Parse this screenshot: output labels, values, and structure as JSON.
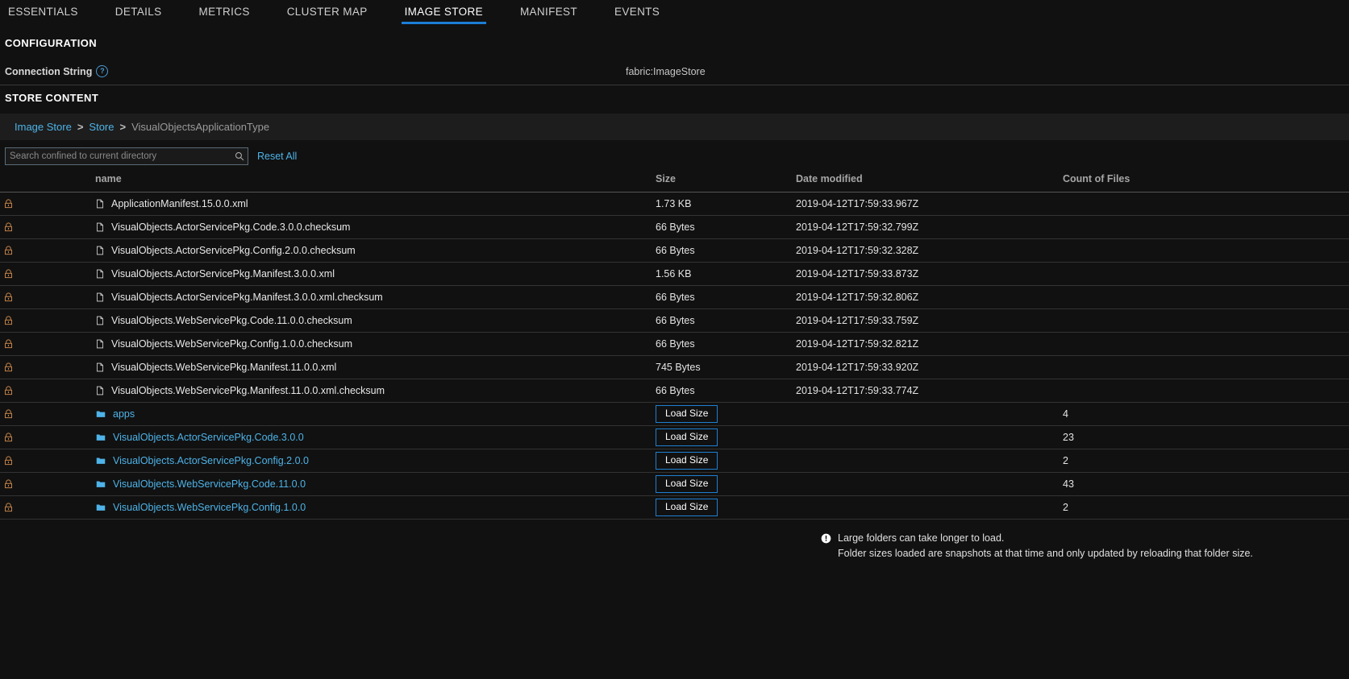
{
  "tabs": [
    {
      "label": "ESSENTIALS",
      "active": false
    },
    {
      "label": "DETAILS",
      "active": false
    },
    {
      "label": "METRICS",
      "active": false
    },
    {
      "label": "CLUSTER MAP",
      "active": false
    },
    {
      "label": "IMAGE STORE",
      "active": true
    },
    {
      "label": "MANIFEST",
      "active": false
    },
    {
      "label": "EVENTS",
      "active": false
    }
  ],
  "configuration": {
    "title": "CONFIGURATION",
    "connection_string_label": "Connection String",
    "help_glyph": "?",
    "connection_string_value": "fabric:ImageStore"
  },
  "store_content": {
    "title": "STORE CONTENT",
    "breadcrumb": {
      "items": [
        {
          "label": "Image Store",
          "link": true
        },
        {
          "label": "Store",
          "link": true
        },
        {
          "label": "VisualObjectsApplicationType",
          "link": false
        }
      ],
      "separator": ">"
    },
    "search": {
      "placeholder": "Search confined to current directory",
      "value": "",
      "icon": "search-icon"
    },
    "reset_all_label": "Reset All",
    "columns": [
      "name",
      "Size",
      "Date modified",
      "Count of Files"
    ],
    "load_size_label": "Load Size",
    "rows": [
      {
        "type": "file",
        "lock": "lock-icon",
        "name": "ApplicationManifest.15.0.0.xml",
        "size": "1.73 KB",
        "date": "2019-04-12T17:59:33.967Z",
        "count": ""
      },
      {
        "type": "file",
        "lock": "lock-icon",
        "name": "VisualObjects.ActorServicePkg.Code.3.0.0.checksum",
        "size": "66 Bytes",
        "date": "2019-04-12T17:59:32.799Z",
        "count": ""
      },
      {
        "type": "file",
        "lock": "lock-icon",
        "name": "VisualObjects.ActorServicePkg.Config.2.0.0.checksum",
        "size": "66 Bytes",
        "date": "2019-04-12T17:59:32.328Z",
        "count": ""
      },
      {
        "type": "file",
        "lock": "lock-icon",
        "name": "VisualObjects.ActorServicePkg.Manifest.3.0.0.xml",
        "size": "1.56 KB",
        "date": "2019-04-12T17:59:33.873Z",
        "count": ""
      },
      {
        "type": "file",
        "lock": "lock-icon",
        "name": "VisualObjects.ActorServicePkg.Manifest.3.0.0.xml.checksum",
        "size": "66 Bytes",
        "date": "2019-04-12T17:59:32.806Z",
        "count": ""
      },
      {
        "type": "file",
        "lock": "lock-icon",
        "name": "VisualObjects.WebServicePkg.Code.11.0.0.checksum",
        "size": "66 Bytes",
        "date": "2019-04-12T17:59:33.759Z",
        "count": ""
      },
      {
        "type": "file",
        "lock": "lock-icon",
        "name": "VisualObjects.WebServicePkg.Config.1.0.0.checksum",
        "size": "66 Bytes",
        "date": "2019-04-12T17:59:32.821Z",
        "count": ""
      },
      {
        "type": "file",
        "lock": "lock-icon",
        "name": "VisualObjects.WebServicePkg.Manifest.11.0.0.xml",
        "size": "745 Bytes",
        "date": "2019-04-12T17:59:33.920Z",
        "count": ""
      },
      {
        "type": "file",
        "lock": "lock-icon",
        "name": "VisualObjects.WebServicePkg.Manifest.11.0.0.xml.checksum",
        "size": "66 Bytes",
        "date": "2019-04-12T17:59:33.774Z",
        "count": ""
      },
      {
        "type": "folder",
        "lock": "lock-icon",
        "name": "apps",
        "size": "Load Size",
        "date": "",
        "count": "4"
      },
      {
        "type": "folder",
        "lock": "lock-icon",
        "name": "VisualObjects.ActorServicePkg.Code.3.0.0",
        "size": "Load Size",
        "date": "",
        "count": "23"
      },
      {
        "type": "folder",
        "lock": "lock-icon",
        "name": "VisualObjects.ActorServicePkg.Config.2.0.0",
        "size": "Load Size",
        "date": "",
        "count": "2"
      },
      {
        "type": "folder",
        "lock": "lock-icon",
        "name": "VisualObjects.WebServicePkg.Code.11.0.0",
        "size": "Load Size",
        "date": "",
        "count": "43"
      },
      {
        "type": "folder",
        "lock": "lock-icon",
        "name": "VisualObjects.WebServicePkg.Config.1.0.0",
        "size": "Load Size",
        "date": "",
        "count": "2"
      }
    ],
    "footer_note": {
      "icon": "alert-icon",
      "line1": "Large folders can take longer to load.",
      "line2": "Folder sizes loaded are snapshots at that time and only updated by reloading that folder size."
    }
  },
  "colors": {
    "accent_blue": "#1c7ed6",
    "link_blue": "#4eb3e8",
    "lock_orange": "#c8864a",
    "folder_blue": "#4eb3e8",
    "background": "#111111"
  }
}
